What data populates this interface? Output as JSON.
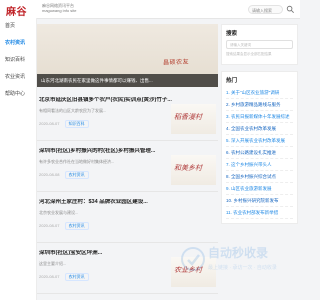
{
  "site": {
    "logo": "麻谷",
    "tagline_cn": "麻谷网络资讯平台",
    "tagline_en": "maguwang info site",
    "search_placeholder": "请输入搜索",
    "brand_red": "#c02328",
    "link_blue": "#1e88e5"
  },
  "nav": {
    "items": [
      {
        "label": "首页"
      },
      {
        "label": "农村资讯",
        "active": true
      },
      {
        "label": "知识百科"
      },
      {
        "label": "农业资讯"
      },
      {
        "label": "帮助中心"
      }
    ]
  },
  "banner": {
    "stamp": "昌硕农友",
    "caption": "山东河北湖南农民在家里做这件事情都可以赚钱、出售..."
  },
  "articles": [
    {
      "title": "北京市延庆区旧县镇多个农户(农民)实训点(黄沙)竹子...",
      "desc": "有相同看法的山区大龄农民为了发展...",
      "date": "2020-08-07",
      "tag": "知识百科",
      "thumb_text": "稻香漫村"
    },
    {
      "title": "深圳市(社区)乡村振兴的村(社区)乡村振兴管理...",
      "desc": "有许多农业合作社在当地做好村集体经济...",
      "date": "2020-08-08",
      "tag": "农村资讯",
      "thumb_text": "和美乡村"
    },
    {
      "title": "河北深州王家庄村：$34 品牌农业园区建设...",
      "desc": "北京农业发展与建设...",
      "date": "2020-08-07",
      "tag": "农村资讯",
      "thumb_text": ""
    },
    {
      "title": "深圳市(社区)宝安区坪洲...",
      "desc": "这里主要介绍...",
      "date": "2020-08-07",
      "tag": "农村资讯",
      "thumb_text": "农业乡村"
    }
  ],
  "sidebar": {
    "search_title": "搜索",
    "search_placeholder": "请输入关键词",
    "search_tip": "搜索结果会显示全部匹配结果",
    "recent_title": "热门",
    "recent": [
      "1. 关于\"山区农业旅游\"调研",
      "2. 乡村旅游精品路线与服务",
      "3. 农民日报新媒体十年发展综述",
      "4. 全国农业农村改革发展",
      "5. 深入开展农业农村改革发展",
      "6. 农村公路建设扎实推进",
      "7. 这个乡村振兴带头人",
      "8. 全国乡村振兴综合试点",
      "9. 山区农业旅游新发展",
      "10. 乡村振兴研究院新发布",
      "11. 农业农村部发布新举措"
    ]
  },
  "watermark": {
    "big": "自动秒收录",
    "small": "最上链接 · 承访一次 · 自动收录"
  }
}
